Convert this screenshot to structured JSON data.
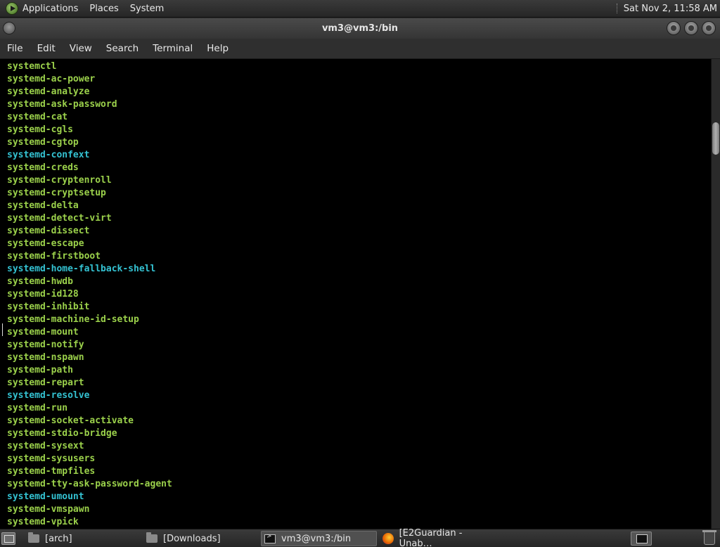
{
  "top_panel": {
    "menus": [
      "Applications",
      "Places",
      "System"
    ],
    "clock": "Sat Nov  2, 11:58 AM"
  },
  "window": {
    "title": "vm3@vm3:/bin"
  },
  "menubar": {
    "items": [
      "File",
      "Edit",
      "View",
      "Search",
      "Terminal",
      "Help"
    ]
  },
  "terminal": {
    "colors": {
      "executable": "#9bd14b",
      "symlink": "#34c2d2",
      "background": "#000000"
    },
    "lines": [
      {
        "text": "systemctl",
        "kind": "exec"
      },
      {
        "text": "systemd-ac-power",
        "kind": "exec"
      },
      {
        "text": "systemd-analyze",
        "kind": "exec"
      },
      {
        "text": "systemd-ask-password",
        "kind": "exec"
      },
      {
        "text": "systemd-cat",
        "kind": "exec"
      },
      {
        "text": "systemd-cgls",
        "kind": "exec"
      },
      {
        "text": "systemd-cgtop",
        "kind": "exec"
      },
      {
        "text": "systemd-confext",
        "kind": "link"
      },
      {
        "text": "systemd-creds",
        "kind": "exec"
      },
      {
        "text": "systemd-cryptenroll",
        "kind": "exec"
      },
      {
        "text": "systemd-cryptsetup",
        "kind": "exec"
      },
      {
        "text": "systemd-delta",
        "kind": "exec"
      },
      {
        "text": "systemd-detect-virt",
        "kind": "exec"
      },
      {
        "text": "systemd-dissect",
        "kind": "exec"
      },
      {
        "text": "systemd-escape",
        "kind": "exec"
      },
      {
        "text": "systemd-firstboot",
        "kind": "exec"
      },
      {
        "text": "systemd-home-fallback-shell",
        "kind": "link"
      },
      {
        "text": "systemd-hwdb",
        "kind": "exec"
      },
      {
        "text": "systemd-id128",
        "kind": "exec"
      },
      {
        "text": "systemd-inhibit",
        "kind": "exec"
      },
      {
        "text": "systemd-machine-id-setup",
        "kind": "exec"
      },
      {
        "text": "systemd-mount",
        "kind": "exec"
      },
      {
        "text": "systemd-notify",
        "kind": "exec"
      },
      {
        "text": "systemd-nspawn",
        "kind": "exec"
      },
      {
        "text": "systemd-path",
        "kind": "exec"
      },
      {
        "text": "systemd-repart",
        "kind": "exec"
      },
      {
        "text": "systemd-resolve",
        "kind": "link"
      },
      {
        "text": "systemd-run",
        "kind": "exec"
      },
      {
        "text": "systemd-socket-activate",
        "kind": "exec"
      },
      {
        "text": "systemd-stdio-bridge",
        "kind": "exec"
      },
      {
        "text": "systemd-sysext",
        "kind": "exec"
      },
      {
        "text": "systemd-sysusers",
        "kind": "exec"
      },
      {
        "text": "systemd-tmpfiles",
        "kind": "exec"
      },
      {
        "text": "systemd-tty-ask-password-agent",
        "kind": "exec"
      },
      {
        "text": "systemd-umount",
        "kind": "link"
      },
      {
        "text": "systemd-vmspawn",
        "kind": "exec"
      },
      {
        "text": "systemd-vpick",
        "kind": "exec"
      }
    ]
  },
  "taskbar": {
    "tasks": [
      {
        "label": "[arch]",
        "icon": "folder-icon"
      },
      {
        "label": "[Downloads]",
        "icon": "folder-icon"
      },
      {
        "label": "vm3@vm3:/bin",
        "icon": "terminal-icon",
        "active": true
      },
      {
        "label": "[E2Guardian - Unab…",
        "icon": "firefox-icon"
      }
    ]
  }
}
